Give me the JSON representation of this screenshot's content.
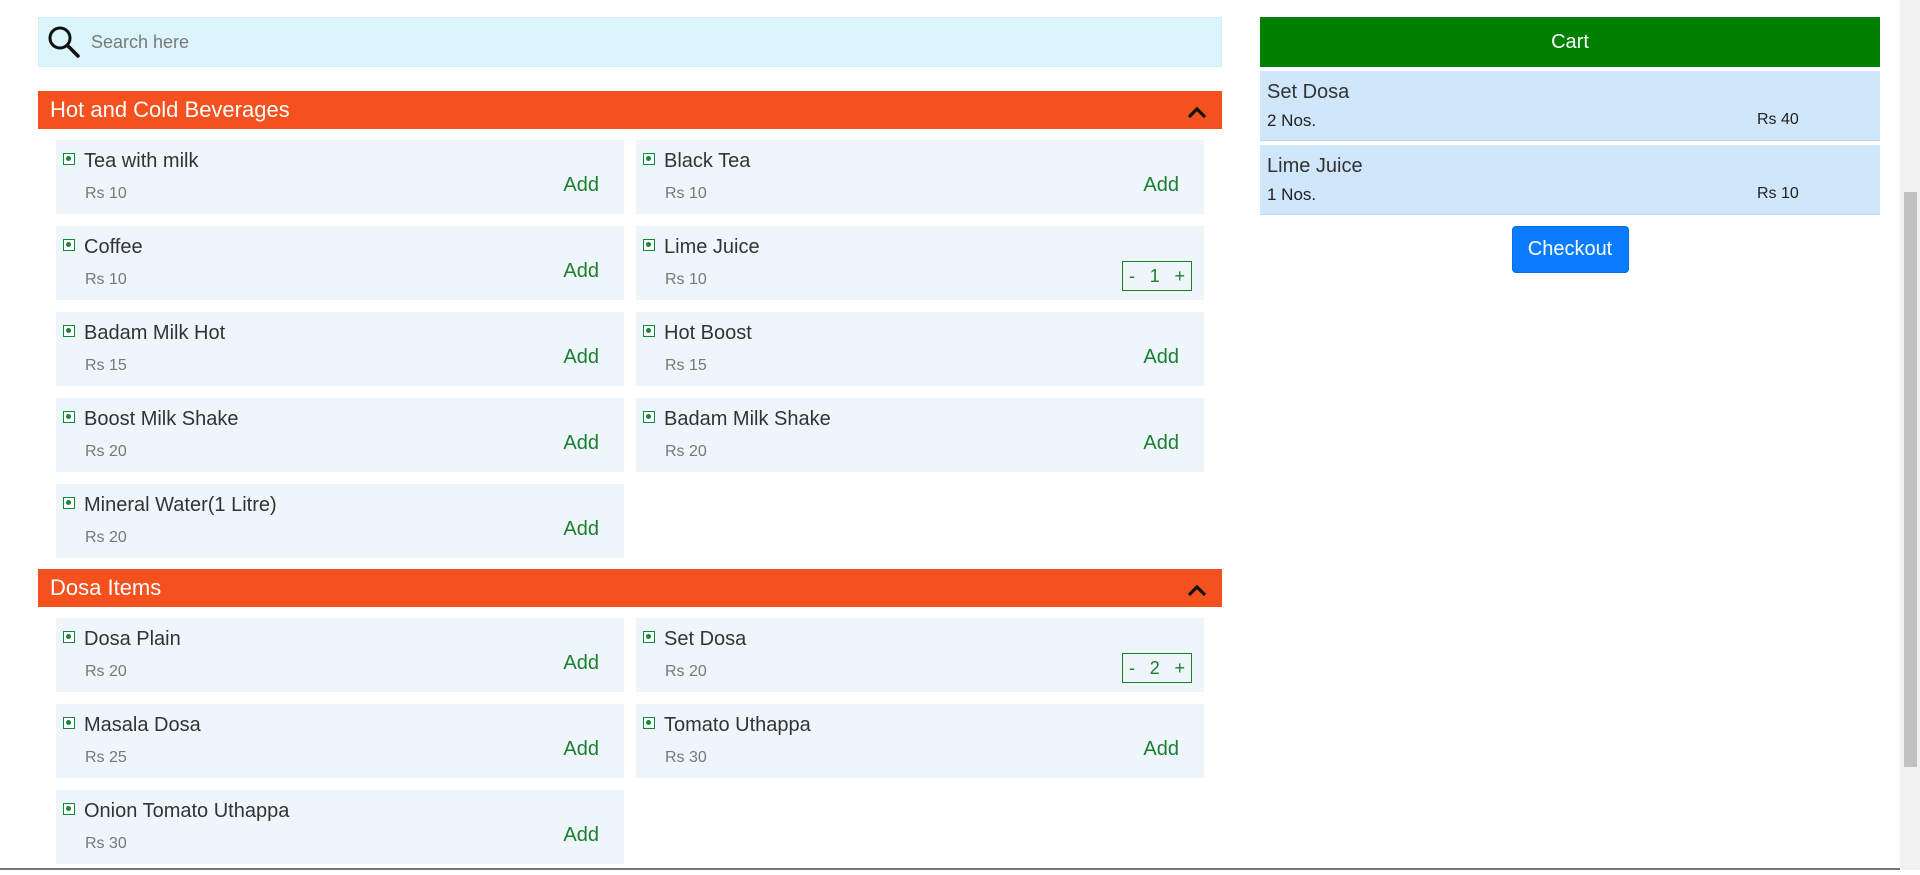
{
  "search": {
    "placeholder": "Search here"
  },
  "categories": [
    {
      "title": "Hot and Cold Beverages",
      "items": [
        {
          "name": "Tea with milk",
          "price": "Rs 10",
          "action": "Add"
        },
        {
          "name": "Black Tea",
          "price": "Rs 10",
          "action": "Add"
        },
        {
          "name": "Coffee",
          "price": "Rs 10",
          "action": "Add"
        },
        {
          "name": "Lime Juice",
          "price": "Rs 10",
          "qty": "1",
          "minus": "-",
          "plus": "+"
        },
        {
          "name": "Badam Milk Hot",
          "price": "Rs 15",
          "action": "Add"
        },
        {
          "name": "Hot Boost",
          "price": "Rs 15",
          "action": "Add"
        },
        {
          "name": "Boost Milk Shake",
          "price": "Rs 20",
          "action": "Add"
        },
        {
          "name": "Badam Milk Shake",
          "price": "Rs 20",
          "action": "Add"
        },
        {
          "name": "Mineral Water(1 Litre)",
          "price": "Rs 20",
          "action": "Add"
        }
      ]
    },
    {
      "title": "Dosa Items",
      "items": [
        {
          "name": "Dosa Plain",
          "price": "Rs 20",
          "action": "Add"
        },
        {
          "name": "Set Dosa",
          "price": "Rs 20",
          "qty": "2",
          "minus": "-",
          "plus": "+"
        },
        {
          "name": "Masala Dosa",
          "price": "Rs 25",
          "action": "Add"
        },
        {
          "name": "Tomato Uthappa",
          "price": "Rs 30",
          "action": "Add"
        },
        {
          "name": "Onion Tomato Uthappa",
          "price": "Rs 30",
          "action": "Add"
        }
      ]
    }
  ],
  "cart": {
    "title": "Cart",
    "items": [
      {
        "name": "Set Dosa",
        "qty": "2 Nos.",
        "price": "Rs 40"
      },
      {
        "name": "Lime Juice",
        "qty": "1 Nos.",
        "price": "Rs 10"
      }
    ],
    "checkout_label": "Checkout"
  },
  "colors": {
    "category_header": "#f4511e",
    "cart_header": "#008000",
    "checkout": "#0a7cff",
    "item_bg": "#eef6fc",
    "veg_mark": "#0f8a3a"
  },
  "icons": {
    "search": "search-icon",
    "collapse": "chevron-up-icon",
    "veg": "veg-indicator-icon"
  }
}
